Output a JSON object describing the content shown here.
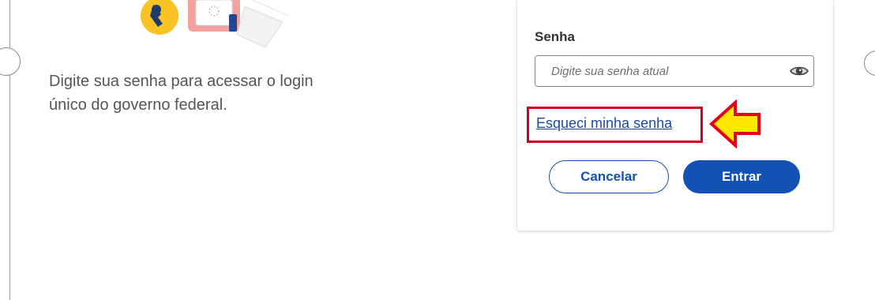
{
  "intro": {
    "text": "Digite sua senha para acessar o login único do governo federal."
  },
  "login_card": {
    "password_label": "Senha",
    "password_placeholder": "Digite sua senha atual",
    "password_value": "",
    "forgot_link": "Esqueci minha senha",
    "cancel_button": "Cancelar",
    "enter_button": "Entrar"
  },
  "annotation": {
    "highlight_color": "#d0021b",
    "arrow_color": "#ffe600"
  },
  "colors": {
    "primary": "#1351b4",
    "link": "#1a4a9e",
    "text": "#555555"
  },
  "icons": [
    "eye-icon",
    "arrow-pointer-icon"
  ]
}
